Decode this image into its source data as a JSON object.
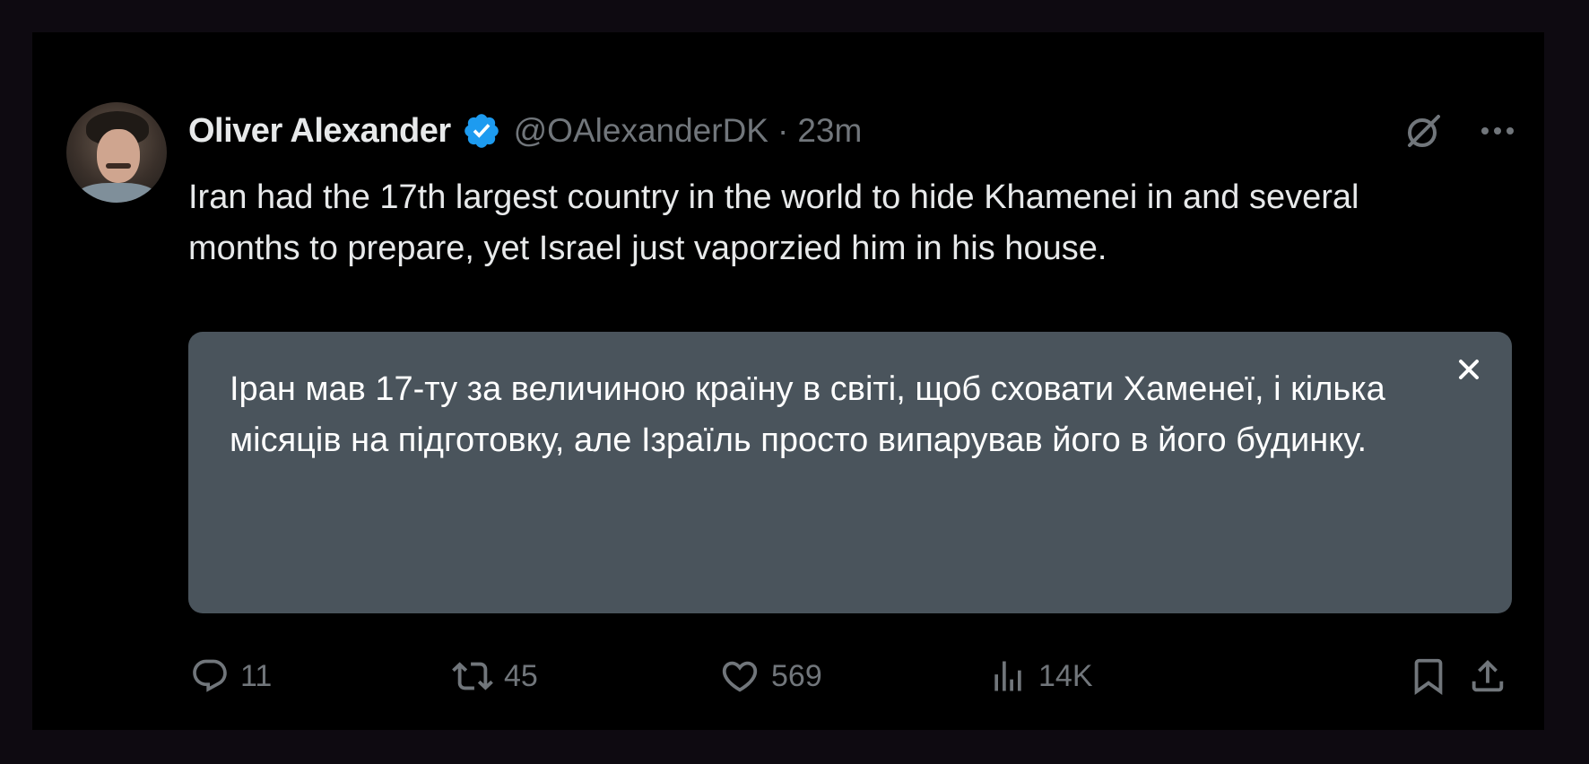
{
  "tweet": {
    "author": {
      "name": "Oliver Alexander",
      "handle": "@OAlexanderDK",
      "verified": true,
      "separator": "·",
      "time": "23m"
    },
    "text": "Iran had the 17th largest country in the world to hide Khamenei in and several months to prepare, yet Israel just vaporzied him in his house.",
    "translation": {
      "text": "Іран мав 17-ту за величиною країну в світі, щоб сховати Хаменеї, і кілька місяців на підготовку, але Ізраїль просто випарував його в його будинку.",
      "close_icon": "close-icon"
    },
    "header_icons": [
      "grok-icon",
      "more-icon"
    ],
    "actions": {
      "replies": "11",
      "reposts": "45",
      "likes": "569",
      "views": "14K",
      "bookmark_icon": "bookmark-icon",
      "share_icon": "share-icon"
    }
  },
  "colors": {
    "page_background": "#0e0a11",
    "card_background": "#000000",
    "primary_text": "#e7e9ea",
    "secondary_text": "#71767b",
    "verified_blue": "#1d9bf0",
    "translation_background": "#4a545c"
  }
}
